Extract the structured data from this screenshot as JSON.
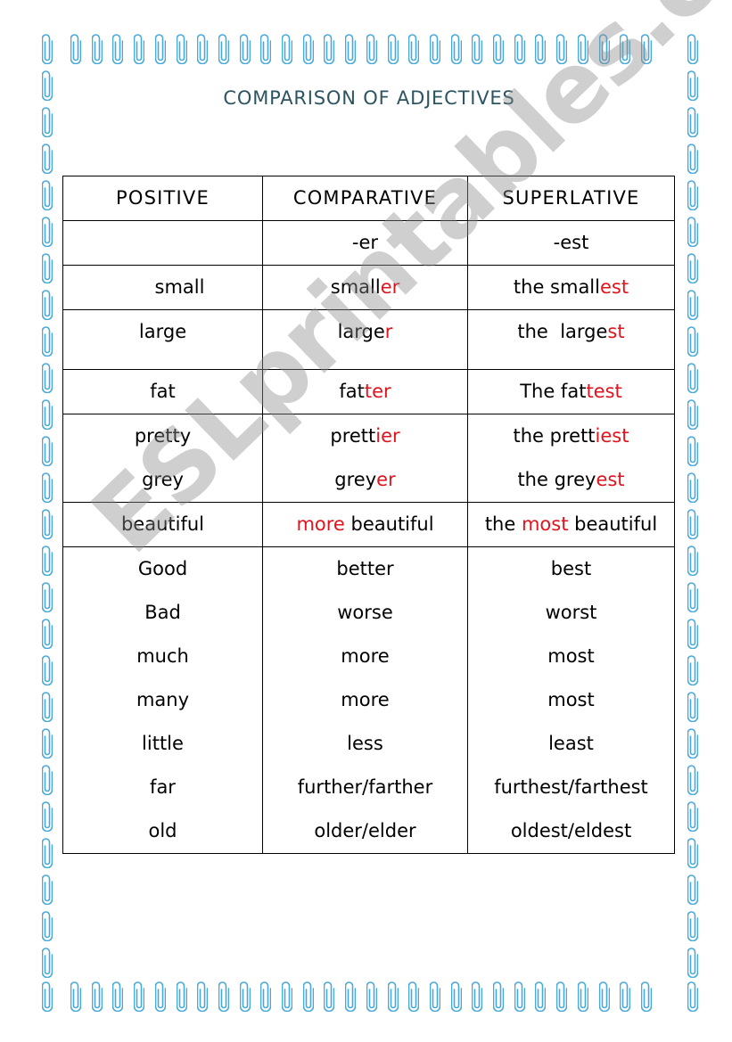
{
  "title": "COMPARISON OF ADJECTIVES",
  "colors": {
    "title": "#2c5561",
    "header": "#5079a6",
    "highlight": "#e0141e",
    "clip": "#47a9d9",
    "watermark": "#a0a0a0"
  },
  "border_icon": "paperclip-icon",
  "watermark": "ESLprintables.com",
  "table": {
    "headers": [
      "POSITIVE",
      "COMPARATIVE",
      "SUPERLATIVE"
    ],
    "suffix_row": {
      "positive": "",
      "comparative": "-er",
      "superlative": "-est"
    },
    "rows": [
      {
        "positive": "small",
        "comparative": {
          "base": "small",
          "suffix": "er"
        },
        "superlative": {
          "base": "the small",
          "suffix": "est"
        }
      },
      {
        "positive": "large",
        "comparative": {
          "base": "large",
          "suffix": "r"
        },
        "superlative": {
          "base": "the  large",
          "suffix": "st"
        }
      },
      {
        "positive": "fat",
        "comparative": {
          "base": "fat",
          "suffix": "ter"
        },
        "superlative": {
          "base": "The fat",
          "suffix": "test"
        }
      },
      {
        "positive": "pretty",
        "comparative": {
          "base": "prett",
          "suffix": "ier"
        },
        "superlative": {
          "base": "the prett",
          "suffix": "iest"
        }
      },
      {
        "positive": "grey",
        "comparative": {
          "base": "grey",
          "suffix": "er"
        },
        "superlative": {
          "base": "the grey",
          "suffix": "est"
        }
      },
      {
        "positive": "beautiful",
        "comparative": {
          "prefix": "more",
          "base": " beautiful"
        },
        "superlative": {
          "pre": "the ",
          "prefix": "most",
          "base": " beautiful"
        }
      }
    ],
    "irregular": [
      {
        "positive": "Good",
        "comparative": "better",
        "superlative": "best"
      },
      {
        "positive": "Bad",
        "comparative": "worse",
        "superlative": "worst"
      },
      {
        "positive": "much",
        "comparative": "more",
        "superlative": "most"
      },
      {
        "positive": "many",
        "comparative": "more",
        "superlative": "most"
      },
      {
        "positive": "little",
        "comparative": "less",
        "superlative": "least"
      },
      {
        "positive": "far",
        "comparative": "further/farther",
        "superlative": "furthest/farthest"
      },
      {
        "positive": "old",
        "comparative": "older/elder",
        "superlative": "oldest/eldest"
      }
    ]
  }
}
